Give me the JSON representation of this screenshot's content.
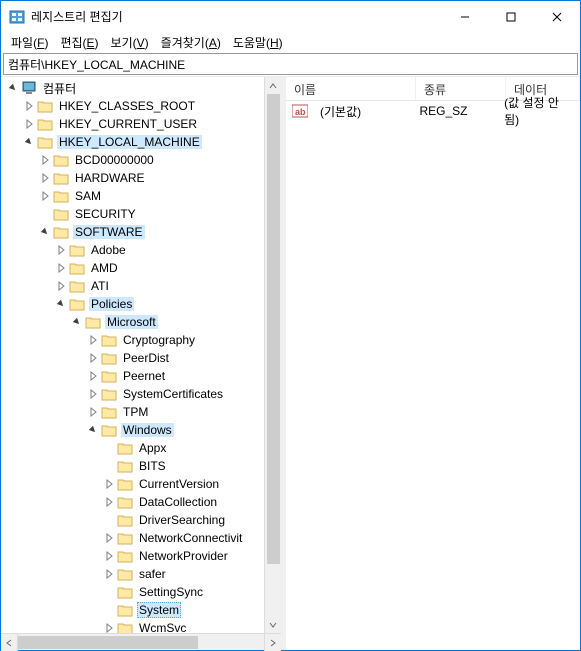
{
  "window": {
    "title": "레지스트리 편집기"
  },
  "menu": {
    "file": "파일",
    "file_u": "F",
    "edit": "편집",
    "edit_u": "E",
    "view": "보기",
    "view_u": "V",
    "fav": "즐겨찾기",
    "fav_u": "A",
    "help": "도움말",
    "help_u": "H"
  },
  "address": "컴퓨터\\HKEY_LOCAL_MACHINE",
  "tree": {
    "root": "컴퓨터",
    "hkcr": "HKEY_CLASSES_ROOT",
    "hkcu": "HKEY_CURRENT_USER",
    "hklm": "HKEY_LOCAL_MACHINE",
    "bcd": "BCD00000000",
    "hardware": "HARDWARE",
    "sam": "SAM",
    "security": "SECURITY",
    "software": "SOFTWARE",
    "adobe": "Adobe",
    "amd": "AMD",
    "ati": "ATI",
    "policies": "Policies",
    "microsoft": "Microsoft",
    "cryptography": "Cryptography",
    "peerdist": "PeerDist",
    "peernet": "Peernet",
    "systemcertificates": "SystemCertificates",
    "tpm": "TPM",
    "windows": "Windows",
    "appx": "Appx",
    "bits": "BITS",
    "currentversion": "CurrentVersion",
    "datacollection": "DataCollection",
    "driversearching": "DriverSearching",
    "networkconnectivit": "NetworkConnectivit",
    "networkprovider": "NetworkProvider",
    "safer": "safer",
    "settingsync": "SettingSync",
    "system": "System",
    "wcmsvc": "WcmSvc"
  },
  "list": {
    "header": {
      "name": "이름",
      "type": "종류",
      "data": "데이터"
    },
    "rows": [
      {
        "name": "(기본값)",
        "type": "REG_SZ",
        "data": "(값 설정 안 됨)"
      }
    ]
  }
}
